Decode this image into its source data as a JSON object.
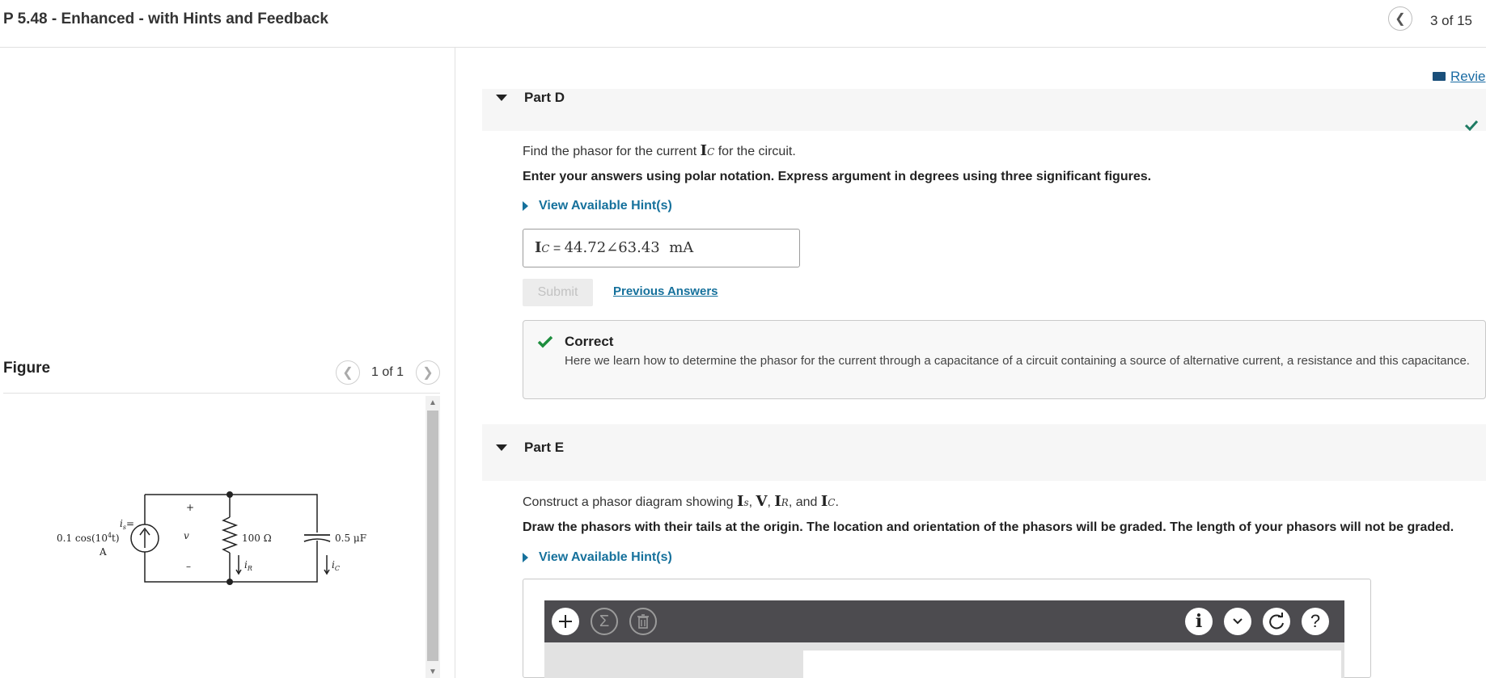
{
  "header": {
    "title": "P 5.48 - Enhanced - with Hints and Feedback",
    "page_counter": "3 of 15"
  },
  "figure": {
    "label": "Figure",
    "counter": "1 of 1",
    "circuit": {
      "source_label_1": "i",
      "source_label_1_sub": "s",
      "source_label_eq": "=",
      "source_label_2": "0.1 cos(10",
      "source_label_2_sup": "4",
      "source_label_2_end": "t)",
      "source_label_3": "A",
      "plus": "+",
      "minus": "–",
      "v": "v",
      "resistor": "100 Ω",
      "ir": "i",
      "ir_sub": "R",
      "capacitor": "0.5 μF",
      "ic": "i",
      "ic_sub": "C"
    }
  },
  "review_link": "Revie",
  "partD": {
    "label": "Part D",
    "prompt_pre": "Find the phasor for the current ",
    "prompt_var": "I",
    "prompt_var_sub": "C",
    "prompt_post": " for the circuit.",
    "instruction": "Enter your answers using polar notation. Express argument in degrees using three significant figures.",
    "hint": "View Available Hint(s)",
    "answer_var": "I",
    "answer_var_sub": "C",
    "answer_eq": " = ",
    "answer_value": "44.72∠63.43  mA",
    "submit": "Submit",
    "previous_answers": "Previous Answers",
    "feedback_title": "Correct",
    "feedback_text": "Here we learn how to determine the phasor for the current through a capacitance of a circuit containing a source of alternative current, a resistance and this capacitance."
  },
  "partE": {
    "label": "Part E",
    "prompt_pre": "Construct a phasor diagram showing ",
    "v1": "I",
    "v1_sub": "s",
    "sep1": ", ",
    "v2": "V",
    "sep2": ", ",
    "v3": "I",
    "v3_sub": "R",
    "sep3": ", and ",
    "v4": "I",
    "v4_sub": "C",
    "prompt_post": ".",
    "instruction": "Draw the phasors with their tails at the origin. The location and orientation of the phasors will be graded. The length of your phasors will not be graded.",
    "hint": "View Available Hint(s)"
  },
  "colors": {
    "accent": "#16719c",
    "correct_green": "#1e8e3e",
    "toolbar_bg": "#4c4b4f"
  }
}
